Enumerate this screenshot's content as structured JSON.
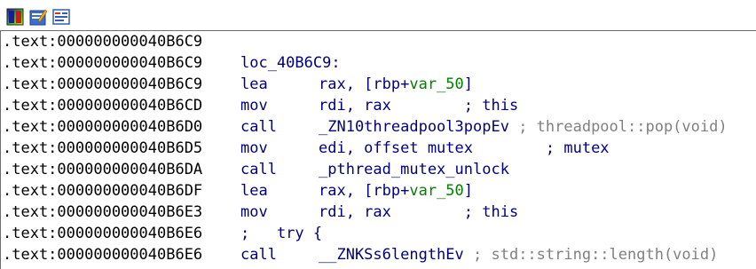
{
  "toolbar": {
    "icons": [
      "graph-view-icon",
      "edit-icon",
      "text-view-icon"
    ]
  },
  "colors": {
    "address": "#000000",
    "instruction": "#000080",
    "variable": "#008000",
    "comment": "#808080",
    "border": "#6d6d6d"
  },
  "lines": [
    {
      "addr": ".text:000000000040B6C9",
      "kind": "blank"
    },
    {
      "addr": ".text:000000000040B6C9",
      "kind": "label",
      "label": "loc_40B6C9:"
    },
    {
      "addr": ".text:000000000040B6C9",
      "kind": "insn",
      "mnem": "lea",
      "op_pre": "rax, [rbp+",
      "op_var": "var_50",
      "op_post": "]"
    },
    {
      "addr": ".text:000000000040B6CD",
      "kind": "insn",
      "mnem": "mov",
      "op_pre": "rdi, rax",
      "op_comment": "; this"
    },
    {
      "addr": ".text:000000000040B6D0",
      "kind": "insn",
      "mnem": "call",
      "op_pre": "_ZN10threadpool3popEv",
      "op_auto": "; threadpool::pop(void)"
    },
    {
      "addr": ".text:000000000040B6D5",
      "kind": "insn",
      "mnem": "mov",
      "op_pre": "edi, offset mutex",
      "op_comment": "; mutex"
    },
    {
      "addr": ".text:000000000040B6DA",
      "kind": "insn",
      "mnem": "call",
      "op_pre": "_pthread_mutex_unlock"
    },
    {
      "addr": ".text:000000000040B6DF",
      "kind": "insn",
      "mnem": "lea",
      "op_pre": "rax, [rbp+",
      "op_var": "var_50",
      "op_post": "]"
    },
    {
      "addr": ".text:000000000040B6E3",
      "kind": "insn",
      "mnem": "mov",
      "op_pre": "rdi, rax",
      "op_comment": "; this"
    },
    {
      "addr": ".text:000000000040B6E6",
      "kind": "code-comment",
      "text": ";   try {"
    },
    {
      "addr": ".text:000000000040B6E6",
      "kind": "insn",
      "mnem": "call",
      "op_pre": "__ZNKSs6lengthEv",
      "op_auto": "; std::string::length(void)"
    }
  ]
}
